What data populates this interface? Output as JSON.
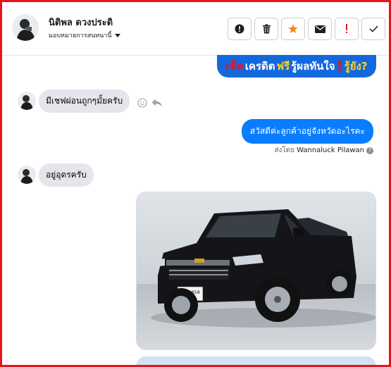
{
  "header": {
    "contact_name": "นิติพล ดวงประดิ",
    "assign_label": "มอบหมายการสนทนานี้",
    "actions": [
      {
        "icon": "alert-circle-icon"
      },
      {
        "icon": "trash-icon"
      },
      {
        "icon": "star-icon"
      },
      {
        "icon": "mail-icon"
      },
      {
        "icon": "exclamation-icon"
      },
      {
        "icon": "check-icon"
      }
    ]
  },
  "banner": {
    "part1": "เช็ค",
    "part2": "เครดิต",
    "part3": "ฟรี",
    "part4": "รู้ผลทันใจ",
    "part5": "!",
    "part6": "รู้ยัง?"
  },
  "messages": [
    {
      "from": "customer",
      "text": "มีเชฟผ่อนถูกๆมั้ยครับ"
    },
    {
      "from": "page",
      "text": "สวัสดีค่ะลูกค้าอยู่จังหวัดอะไรคะ",
      "sent_by_prefix": "ส่งโดย",
      "sent_by_name": "Wannaluck Pilawan"
    },
    {
      "from": "customer",
      "text": "อยู่อุดรครับ"
    }
  ],
  "photo": {
    "plate_text": "ฆพ 9858",
    "plate_sub": "กรุงเทพฯ"
  },
  "colors": {
    "frame": "#e8141c",
    "outgoing_bubble": "#0a7cff",
    "incoming_bubble": "#e4e6eb",
    "star": "#f08a1c",
    "exclamation": "#e8141c",
    "banner_bg": "#1368dd"
  }
}
